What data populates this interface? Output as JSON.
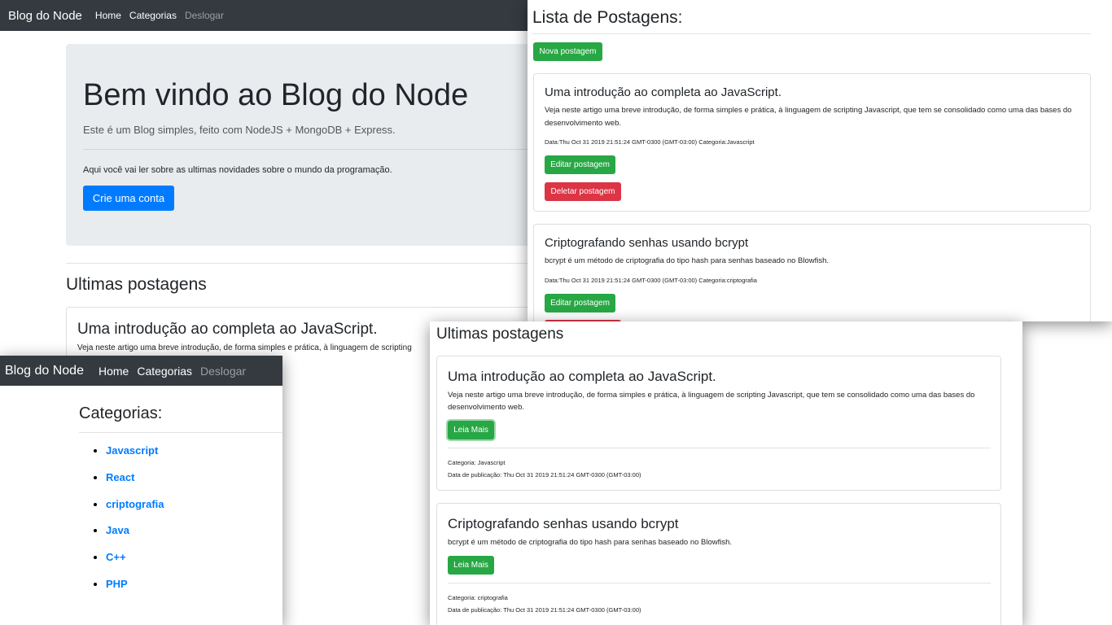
{
  "colors": {
    "navbar_bg": "#343a40",
    "primary": "#007bff",
    "success": "#28a745",
    "danger": "#dc3545",
    "jumbotron_bg": "#e9ecef"
  },
  "home": {
    "navbar": {
      "brand": "Blog do Node",
      "links": [
        "Home",
        "Categorias",
        "Deslogar"
      ]
    },
    "jumbotron": {
      "title": "Bem vindo ao Blog do Node",
      "lead": "Este é um Blog simples, feito com NodeJS + MongoDB + Express.",
      "text": "Aqui você vai ler sobre as ultimas novidades sobre o mundo da programação.",
      "button": "Crie uma conta"
    },
    "latest_heading": "Ultimas postagens",
    "first_post": {
      "title": "Uma introdução ao completa ao JavaScript.",
      "description": "Veja neste artigo uma breve introdução, de forma simples e prática, à linguagem de scripting"
    }
  },
  "categories": {
    "navbar": {
      "brand": "Blog do Node",
      "links": [
        "Home",
        "Categorias",
        "Deslogar"
      ]
    },
    "title": "Categorias:",
    "items": [
      "Javascript",
      "React",
      "criptografia",
      "Java",
      "C++",
      "PHP"
    ]
  },
  "admin": {
    "title": "Lista de Postagens:",
    "new_button": "Nova postagem",
    "posts": [
      {
        "title": "Uma introdução ao completa ao JavaScript.",
        "description": "Veja neste artigo uma breve introdução, de forma simples e prática, à linguagem de scripting Javascript, que tem se consolidado como uma das bases do desenvolvimento web.",
        "meta": "Data:Thu Oct 31 2019 21:51:24 GMT-0300 (GMT-03:00) Categoria:Javascript",
        "edit": "Editar postagem",
        "delete": "Deletar postagem"
      },
      {
        "title": "Criptografando senhas usando bcrypt",
        "description": "bcrypt é um método de criptografia do tipo hash para senhas baseado no Blowfish.",
        "meta": "Data:Thu Oct 31 2019 21:51:24 GMT-0300 (GMT-03:00) Categoria:criptografia",
        "edit": "Editar postagem"
      }
    ]
  },
  "latest": {
    "heading": "Ultimas postagens",
    "posts": [
      {
        "title": "Uma introdução ao completa ao JavaScript.",
        "description": "Veja neste artigo uma breve introdução, de forma simples e prática, à linguagem de scripting Javascript, que tem se consolidado como uma das bases do desenvolvimento web.",
        "button": "Leia Mais",
        "category": "Categoria: Javascript",
        "date": "Data de publicação: Thu Oct 31 2019 21:51:24 GMT-0300 (GMT-03:00)"
      },
      {
        "title": "Criptografando senhas usando bcrypt",
        "description": "bcrypt é um método de criptografia do tipo hash para senhas baseado no Blowfish.",
        "button": "Leia Mais",
        "category": "Categoria: criptografia",
        "date": "Data de publicação: Thu Oct 31 2019 21:51:24 GMT-0300 (GMT-03:00)"
      }
    ]
  }
}
